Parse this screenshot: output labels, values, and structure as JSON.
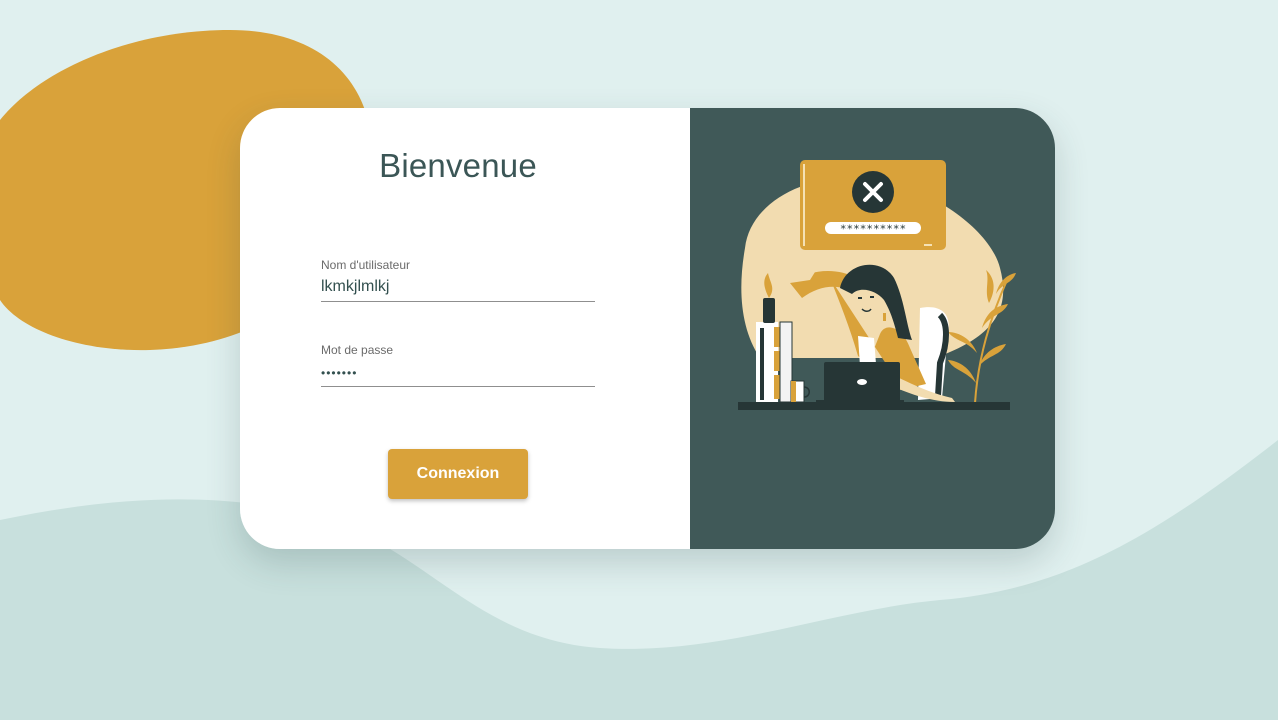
{
  "login": {
    "title": "Bienvenue",
    "username_label": "Nom d'utilisateur",
    "username_value": "lkmkjlmlkj",
    "password_label": "Mot de passe",
    "password_value": "•••••••",
    "submit_label": "Connexion"
  },
  "illustration": {
    "dialog_icon": "close-icon",
    "dialog_password_mask": "**********"
  },
  "colors": {
    "background": "#e0f0ef",
    "wave": "#c8e0dd",
    "accent": "#d9a23a",
    "panel_dark": "#405958",
    "title_text": "#3b5656"
  }
}
